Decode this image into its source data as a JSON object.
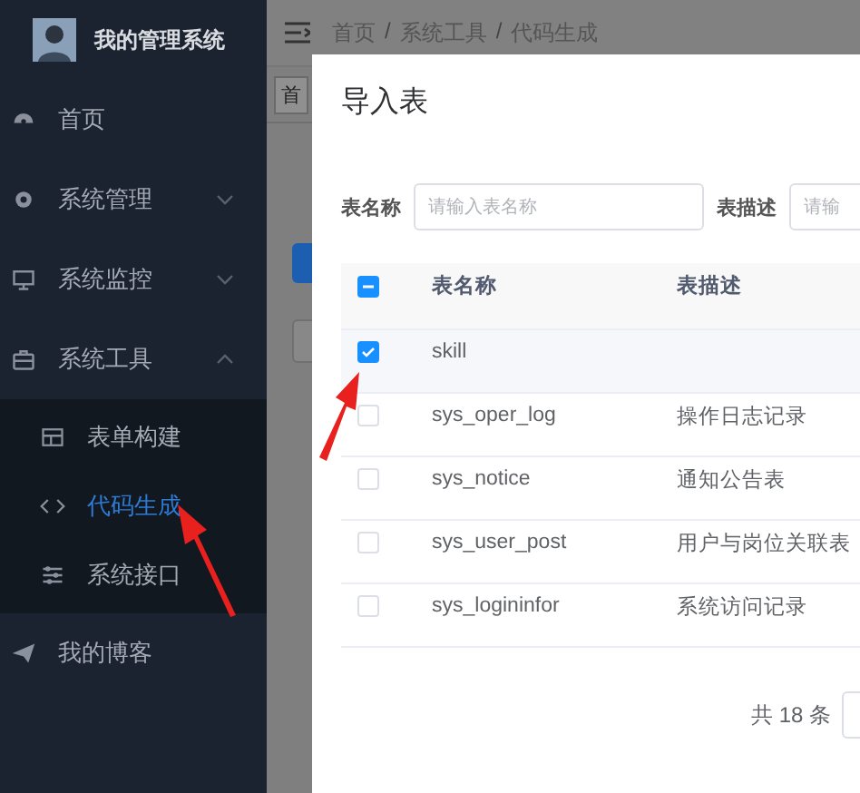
{
  "sidebar": {
    "title": "我的管理系统",
    "items": [
      {
        "label": "首页"
      },
      {
        "label": "系统管理",
        "expanded": false
      },
      {
        "label": "系统监控",
        "expanded": false
      },
      {
        "label": "系统工具",
        "expanded": true,
        "children": [
          {
            "label": "表单构建",
            "selected": false
          },
          {
            "label": "代码生成",
            "selected": true
          },
          {
            "label": "系统接口",
            "selected": false
          }
        ]
      },
      {
        "label": "我的博客"
      }
    ]
  },
  "header": {
    "breadcrumb": [
      "首页",
      "系统工具",
      "代码生成"
    ],
    "separator": "/",
    "tags": [
      "首"
    ]
  },
  "dialog": {
    "title": "导入表",
    "filters": [
      {
        "label": "表名称",
        "placeholder": "请输入表名称"
      },
      {
        "label": "表描述",
        "placeholder": "请输"
      }
    ],
    "table": {
      "columns": [
        "表名称",
        "表描述"
      ],
      "header_checkbox": {
        "indeterminate": true
      },
      "rows": [
        {
          "name": "skill",
          "selected": true
        },
        {
          "name": "sys_oper_log",
          "description": "操作日志记录",
          "selected": false
        },
        {
          "name": "sys_notice",
          "description": "通知公告表",
          "selected": false
        },
        {
          "name": "sys_user_post",
          "description": "用户与岗位关联表",
          "selected": false
        },
        {
          "name": "sys_logininfor",
          "description": "系统访问记录",
          "selected": false
        }
      ]
    },
    "pagination": {
      "total": "共 18 条"
    }
  }
}
